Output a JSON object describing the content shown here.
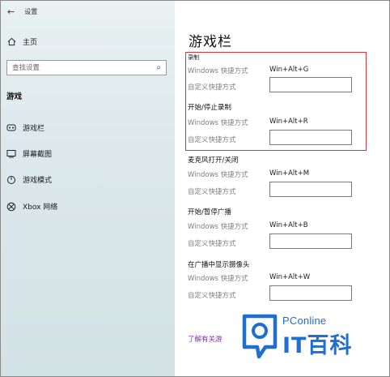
{
  "window": {
    "title": "设置"
  },
  "sidebar": {
    "home": {
      "label": "主页",
      "icon": "home-icon"
    },
    "search": {
      "placeholder": "查找设置"
    },
    "section_title": "游戏",
    "items": [
      {
        "label": "游戏栏",
        "icon": "game-bar-icon"
      },
      {
        "label": "屏幕截图",
        "icon": "screenshot-icon"
      },
      {
        "label": "游戏模式",
        "icon": "game-mode-icon"
      },
      {
        "label": "Xbox 网络",
        "icon": "xbox-icon"
      }
    ]
  },
  "main": {
    "page_title": "游戏栏",
    "groups": [
      {
        "title": "录制",
        "windows_label": "Windows 快捷方式",
        "shortcut": "Win+Alt+G",
        "custom_label": "自定义快捷方式",
        "custom_value": ""
      },
      {
        "title": "开始/停止录制",
        "windows_label": "Windows 快捷方式",
        "shortcut": "Win+Alt+R",
        "custom_label": "自定义快捷方式",
        "custom_value": ""
      },
      {
        "title": "麦克风打开/关闭",
        "windows_label": "Windows 快捷方式",
        "shortcut": "Win+Alt+M",
        "custom_label": "自定义快捷方式",
        "custom_value": ""
      },
      {
        "title": "开始/暂停广播",
        "windows_label": "Windows 快捷方式",
        "shortcut": "Win+Alt+B",
        "custom_label": "自定义快捷方式",
        "custom_value": ""
      },
      {
        "title": "在广播中显示摄像头",
        "windows_label": "Windows 快捷方式",
        "shortcut": "Win+Alt+W",
        "custom_label": "自定义快捷方式",
        "custom_value": ""
      }
    ],
    "link": "了解有关游"
  },
  "watermark": {
    "top": "PConline",
    "brand": "IT百科"
  },
  "colors": {
    "highlight": "#d9343b",
    "link": "#8b2bb8",
    "watermark": "#1f6fd1"
  }
}
